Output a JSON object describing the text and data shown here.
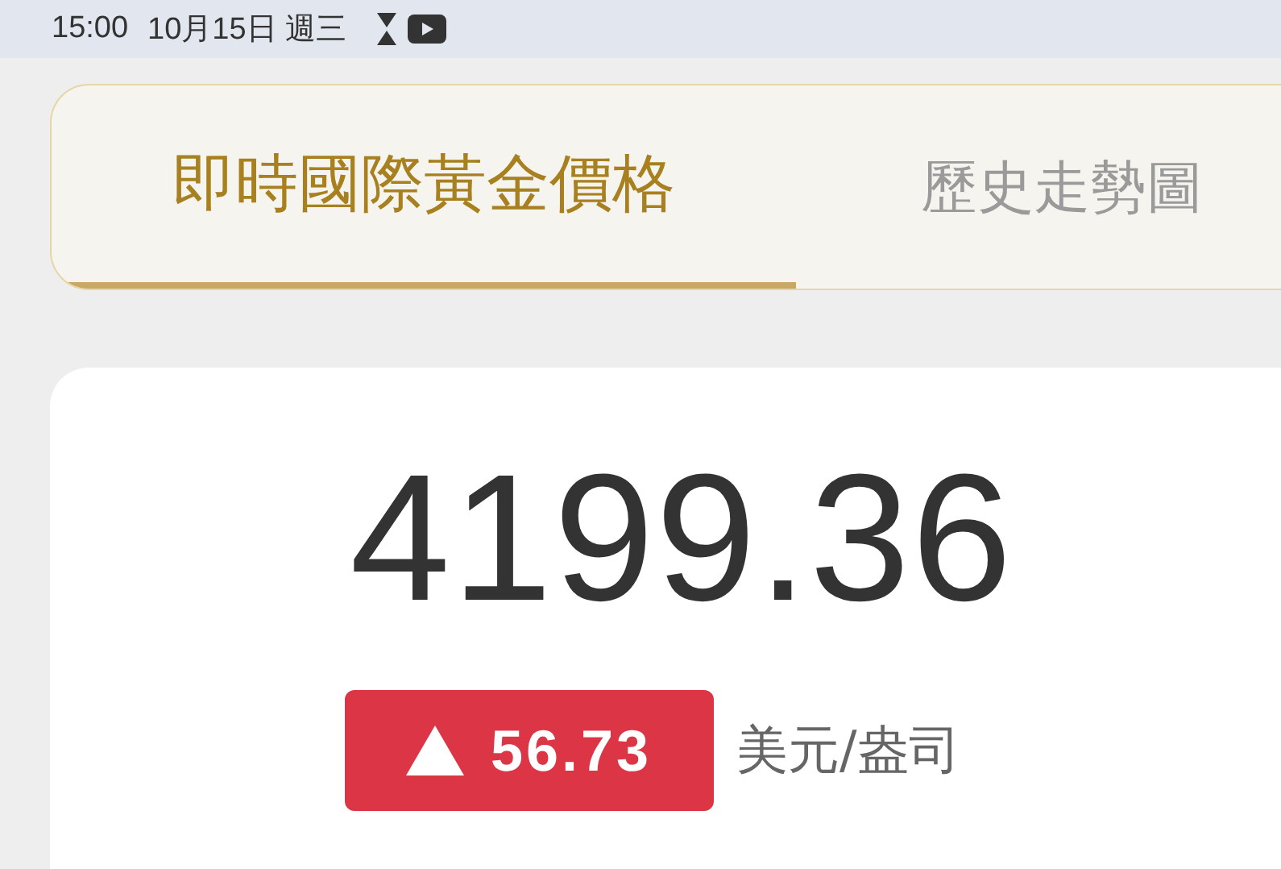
{
  "status_bar": {
    "time": "15:00",
    "date": "10月15日 週三"
  },
  "tabs": [
    {
      "label": "即時國際黃金價格",
      "selected": true
    },
    {
      "label": "歷史走勢圖",
      "selected": false
    }
  ],
  "price": {
    "value": "4199.36",
    "change": {
      "rising": true,
      "value": "56.73"
    },
    "unit": "美元/盎司"
  }
}
